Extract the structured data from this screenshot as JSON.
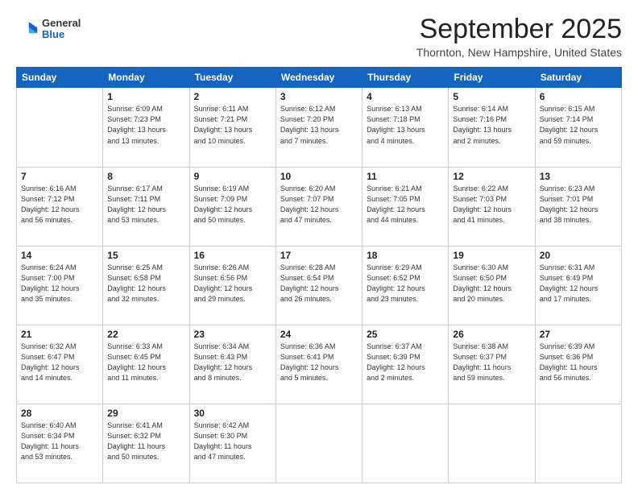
{
  "header": {
    "logo": {
      "general": "General",
      "blue": "Blue"
    },
    "month": "September 2025",
    "location": "Thornton, New Hampshire, United States"
  },
  "weekdays": [
    "Sunday",
    "Monday",
    "Tuesday",
    "Wednesday",
    "Thursday",
    "Friday",
    "Saturday"
  ],
  "weeks": [
    [
      {
        "day": "",
        "info": ""
      },
      {
        "day": "1",
        "info": "Sunrise: 6:09 AM\nSunset: 7:23 PM\nDaylight: 13 hours\nand 13 minutes."
      },
      {
        "day": "2",
        "info": "Sunrise: 6:11 AM\nSunset: 7:21 PM\nDaylight: 13 hours\nand 10 minutes."
      },
      {
        "day": "3",
        "info": "Sunrise: 6:12 AM\nSunset: 7:20 PM\nDaylight: 13 hours\nand 7 minutes."
      },
      {
        "day": "4",
        "info": "Sunrise: 6:13 AM\nSunset: 7:18 PM\nDaylight: 13 hours\nand 4 minutes."
      },
      {
        "day": "5",
        "info": "Sunrise: 6:14 AM\nSunset: 7:16 PM\nDaylight: 13 hours\nand 2 minutes."
      },
      {
        "day": "6",
        "info": "Sunrise: 6:15 AM\nSunset: 7:14 PM\nDaylight: 12 hours\nand 59 minutes."
      }
    ],
    [
      {
        "day": "7",
        "info": "Sunrise: 6:16 AM\nSunset: 7:12 PM\nDaylight: 12 hours\nand 56 minutes."
      },
      {
        "day": "8",
        "info": "Sunrise: 6:17 AM\nSunset: 7:11 PM\nDaylight: 12 hours\nand 53 minutes."
      },
      {
        "day": "9",
        "info": "Sunrise: 6:19 AM\nSunset: 7:09 PM\nDaylight: 12 hours\nand 50 minutes."
      },
      {
        "day": "10",
        "info": "Sunrise: 6:20 AM\nSunset: 7:07 PM\nDaylight: 12 hours\nand 47 minutes."
      },
      {
        "day": "11",
        "info": "Sunrise: 6:21 AM\nSunset: 7:05 PM\nDaylight: 12 hours\nand 44 minutes."
      },
      {
        "day": "12",
        "info": "Sunrise: 6:22 AM\nSunset: 7:03 PM\nDaylight: 12 hours\nand 41 minutes."
      },
      {
        "day": "13",
        "info": "Sunrise: 6:23 AM\nSunset: 7:01 PM\nDaylight: 12 hours\nand 38 minutes."
      }
    ],
    [
      {
        "day": "14",
        "info": "Sunrise: 6:24 AM\nSunset: 7:00 PM\nDaylight: 12 hours\nand 35 minutes."
      },
      {
        "day": "15",
        "info": "Sunrise: 6:25 AM\nSunset: 6:58 PM\nDaylight: 12 hours\nand 32 minutes."
      },
      {
        "day": "16",
        "info": "Sunrise: 6:26 AM\nSunset: 6:56 PM\nDaylight: 12 hours\nand 29 minutes."
      },
      {
        "day": "17",
        "info": "Sunrise: 6:28 AM\nSunset: 6:54 PM\nDaylight: 12 hours\nand 26 minutes."
      },
      {
        "day": "18",
        "info": "Sunrise: 6:29 AM\nSunset: 6:52 PM\nDaylight: 12 hours\nand 23 minutes."
      },
      {
        "day": "19",
        "info": "Sunrise: 6:30 AM\nSunset: 6:50 PM\nDaylight: 12 hours\nand 20 minutes."
      },
      {
        "day": "20",
        "info": "Sunrise: 6:31 AM\nSunset: 6:49 PM\nDaylight: 12 hours\nand 17 minutes."
      }
    ],
    [
      {
        "day": "21",
        "info": "Sunrise: 6:32 AM\nSunset: 6:47 PM\nDaylight: 12 hours\nand 14 minutes."
      },
      {
        "day": "22",
        "info": "Sunrise: 6:33 AM\nSunset: 6:45 PM\nDaylight: 12 hours\nand 11 minutes."
      },
      {
        "day": "23",
        "info": "Sunrise: 6:34 AM\nSunset: 6:43 PM\nDaylight: 12 hours\nand 8 minutes."
      },
      {
        "day": "24",
        "info": "Sunrise: 6:36 AM\nSunset: 6:41 PM\nDaylight: 12 hours\nand 5 minutes."
      },
      {
        "day": "25",
        "info": "Sunrise: 6:37 AM\nSunset: 6:39 PM\nDaylight: 12 hours\nand 2 minutes."
      },
      {
        "day": "26",
        "info": "Sunrise: 6:38 AM\nSunset: 6:37 PM\nDaylight: 11 hours\nand 59 minutes."
      },
      {
        "day": "27",
        "info": "Sunrise: 6:39 AM\nSunset: 6:36 PM\nDaylight: 11 hours\nand 56 minutes."
      }
    ],
    [
      {
        "day": "28",
        "info": "Sunrise: 6:40 AM\nSunset: 6:34 PM\nDaylight: 11 hours\nand 53 minutes."
      },
      {
        "day": "29",
        "info": "Sunrise: 6:41 AM\nSunset: 6:32 PM\nDaylight: 11 hours\nand 50 minutes."
      },
      {
        "day": "30",
        "info": "Sunrise: 6:42 AM\nSunset: 6:30 PM\nDaylight: 11 hours\nand 47 minutes."
      },
      {
        "day": "",
        "info": ""
      },
      {
        "day": "",
        "info": ""
      },
      {
        "day": "",
        "info": ""
      },
      {
        "day": "",
        "info": ""
      }
    ]
  ]
}
